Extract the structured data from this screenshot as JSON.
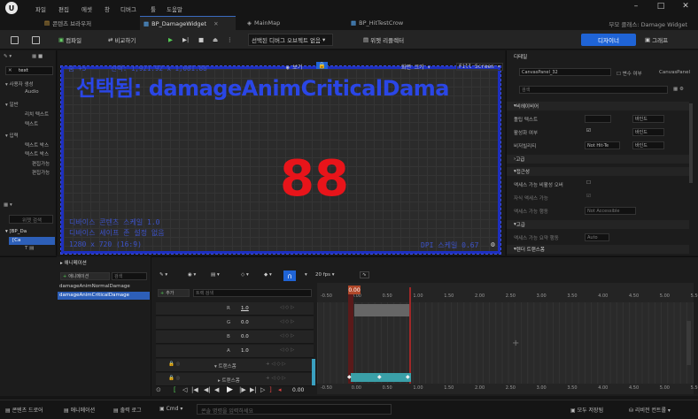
{
  "menu": {
    "items": [
      "파일",
      "편집",
      "에셋",
      "창",
      "디버그",
      "툴",
      "도움말"
    ]
  },
  "tabs": [
    {
      "label": "콘텐츠 브라우저"
    },
    {
      "label": "BP_DamageWidget"
    },
    {
      "label": "MainMap"
    },
    {
      "label": "BP_HitTestCrow"
    }
  ],
  "source_control": "부모 클래스: Damage Widget",
  "toolbar": {
    "compile": "컴파일",
    "diff": "비교하기",
    "debug_object": "선택된 디버그 오브젝트 없음",
    "widget_reflector": "위젯 리플렉터",
    "designer": "디자이너",
    "graph": "그래프"
  },
  "left_panel": {
    "palette_search": "text",
    "user_created": "사용자 생성",
    "audio": "Audio",
    "common": "일반",
    "rich_text": "리치 텍스트",
    "text": "텍스트",
    "input": "입력",
    "text_box1": "텍스트 박스",
    "text_box2": "텍스트 박스",
    "editable": "편집가능",
    "editable2": "편집가능",
    "hierarchy_search": "위젯 검색",
    "root": "[BP_Da",
    "canvas": "[Ca"
  },
  "viewport": {
    "zoom": "줌 +5",
    "selection_size": "선택: 1,921.92 x 1,081.88",
    "selected_label": "선택됨: damageAnimCriticalDama",
    "number_text": "88",
    "device_scale": "디바이스 콘텐츠 스케일 1.0",
    "safe_zone": "디바이스 세이프 존 설정 없음",
    "resolution": "1280 x 720 (16:9)",
    "dpi": "DPI 스케일 0.67",
    "fill_screen": "Fill Screen",
    "screen_size": "화면 크기",
    "view": "보기"
  },
  "details": {
    "title": "디테일",
    "component_name": "CanvasPanel_32",
    "is_variable": "변수 여부",
    "class_name": "CanvasPanel",
    "search": "검색",
    "behavior": "비헤이비어",
    "tooltip": "툴팁 텍스트",
    "enabled": "활성화 여부",
    "visibility": "비저빌리티",
    "visibility_value": "Not Hit-Te",
    "bind1": "바인드",
    "bind2": "바인드",
    "bind3": "바인드",
    "advanced": "고급",
    "accessibility": "접근성",
    "overrides": "액세스 가능 비활성 오버",
    "children_access": "자식 액세스 가능",
    "access_behavior": "액세스 가능 행동",
    "access_value": "Not Accessible",
    "adv2": "고급",
    "summary_behavior": "액세스 가능 요약 행동",
    "auto": "Auto",
    "render": "렌더 트랜스폼"
  },
  "animations": {
    "title": "애니메이션",
    "add": "애니메이션",
    "search": "검색",
    "items": [
      "damageAnimNormalDamage",
      "damageAnimCriticalDamage"
    ]
  },
  "sequencer": {
    "fps": "20 fps",
    "add_track": "추가",
    "track_search": "트랙 검색",
    "channels": [
      {
        "name": "R",
        "value": "1.0"
      },
      {
        "name": "G",
        "value": "0.0"
      },
      {
        "name": "B",
        "value": "0.0"
      },
      {
        "name": "A",
        "value": "1.0"
      }
    ],
    "transform": "트랜스폼",
    "transform2": "트랜스폼",
    "current_time": "0.00",
    "start_time": "0.00",
    "ticks": [
      "-0.50",
      "0.00",
      "0.50",
      "1.00",
      "1.50",
      "2.00",
      "2.50",
      "3.00",
      "3.50",
      "4.00",
      "4.50",
      "5.00",
      "5.50"
    ]
  },
  "status": {
    "content_drawer": "콘텐츠 드로어",
    "anim": "애니메이션",
    "output_log": "출력 로그",
    "cmd": "Cmd",
    "console": "콘솔 명령을 입력하세요",
    "save_all": "모두 저장됨",
    "revision": "리비전 컨트롤"
  }
}
